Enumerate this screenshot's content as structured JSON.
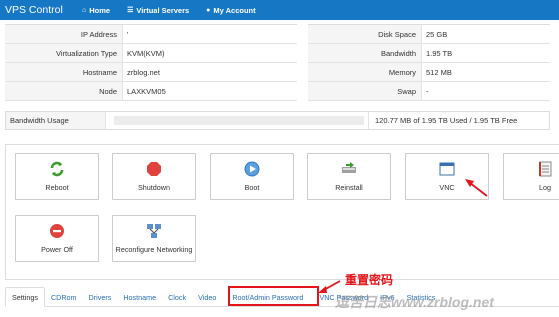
{
  "navbar": {
    "brand": "VPS Control",
    "items": [
      {
        "label": "Home",
        "icon": "home-icon"
      },
      {
        "label": "Virtual Servers",
        "icon": "list-icon"
      },
      {
        "label": "My Account",
        "icon": "user-icon"
      }
    ]
  },
  "info_left": [
    {
      "key": "IP Address",
      "value": "'"
    },
    {
      "key": "Virtualization Type",
      "value": "KVM(KVM)"
    },
    {
      "key": "Hostname",
      "value": "zrblog.net"
    },
    {
      "key": "Node",
      "value": "LAXKVM05"
    }
  ],
  "info_right": [
    {
      "key": "Disk Space",
      "value": "25 GB"
    },
    {
      "key": "Bandwidth",
      "value": "1.95 TB"
    },
    {
      "key": "Memory",
      "value": "512 MB"
    },
    {
      "key": "Swap",
      "value": "-"
    }
  ],
  "bandwidth": {
    "label": "Bandwidth Usage",
    "usage_fraction": 0.0,
    "text": "120.77 MB of 1.95 TB Used / 1.95 TB Free"
  },
  "controls": [
    {
      "label": "Reboot",
      "icon": "reboot-icon"
    },
    {
      "label": "Shutdown",
      "icon": "shutdown-icon"
    },
    {
      "label": "Boot",
      "icon": "boot-icon"
    },
    {
      "label": "Reinstall",
      "icon": "reinstall-icon"
    },
    {
      "label": "VNC",
      "icon": "vnc-icon"
    },
    {
      "label": "Log",
      "icon": "log-icon"
    },
    {
      "label": "Power Off",
      "icon": "power-off-icon"
    },
    {
      "label": "Reconfigure Networking",
      "icon": "network-icon"
    }
  ],
  "tabs": [
    {
      "label": "Settings",
      "active": true
    },
    {
      "label": "CDRom"
    },
    {
      "label": "Drivers"
    },
    {
      "label": "Hostname"
    },
    {
      "label": "Clock"
    },
    {
      "label": "Video"
    },
    {
      "label": "Root/Admin Password"
    },
    {
      "label": "VNC Password"
    },
    {
      "label": "IPv6"
    },
    {
      "label": "Statistics"
    }
  ],
  "annotation": {
    "text": "重置密码",
    "watermark": "逗苦日志www.zrblog.net",
    "color": "#e5141b"
  }
}
